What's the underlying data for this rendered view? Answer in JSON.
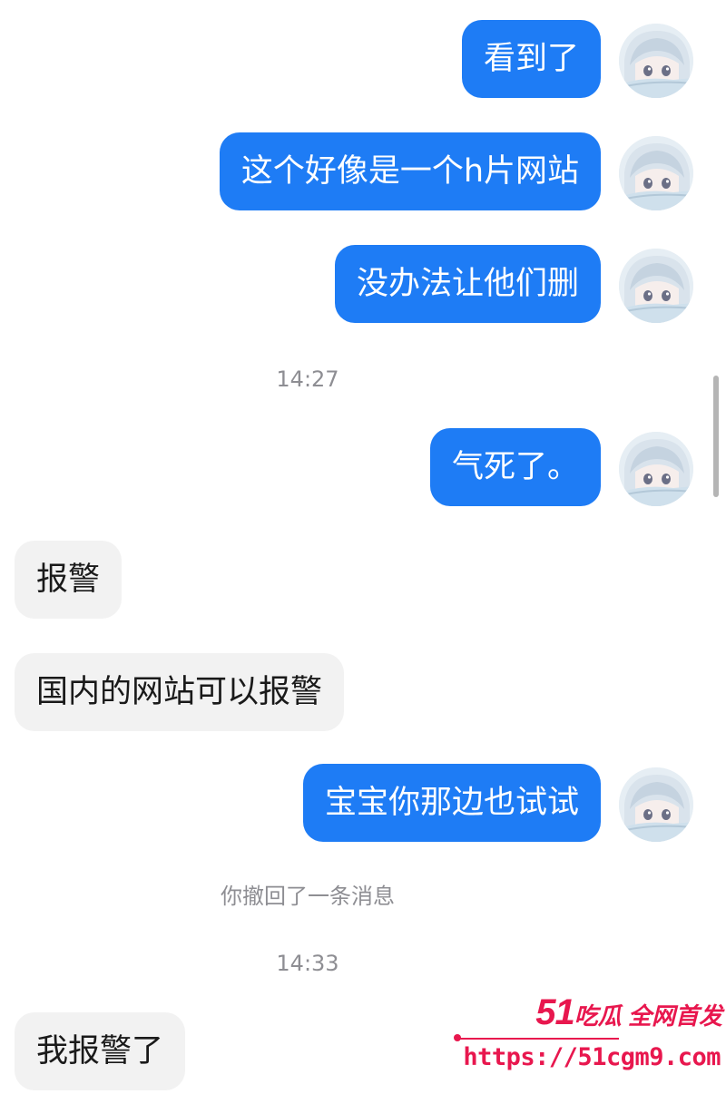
{
  "messages": [
    {
      "side": "out",
      "text": "看到了"
    },
    {
      "side": "out",
      "text": "这个好像是一个h片网站"
    },
    {
      "side": "out",
      "text": "没办法让他们删"
    },
    {
      "timestamp": "14:27"
    },
    {
      "side": "out",
      "text": "气死了。"
    },
    {
      "side": "in",
      "text": "报警"
    },
    {
      "side": "in",
      "text": "国内的网站可以报警"
    },
    {
      "side": "out",
      "text": "宝宝你那边也试试"
    },
    {
      "system": "你撤回了一条消息"
    },
    {
      "timestamp": "14:33"
    },
    {
      "side": "in",
      "text": "我报警了"
    }
  ],
  "watermark": {
    "brand_number": "51",
    "brand_text": "吃瓜 全网首发",
    "url": "https://51cgm9.com"
  },
  "colors": {
    "outgoing_bubble": "#1e7cf5",
    "incoming_bubble": "#f2f2f2",
    "watermark": "#e8174e",
    "meta_text": "#8e8e93"
  },
  "icons": {
    "avatar": "anime-girl-avatar",
    "scrollbar": "scroll-indicator"
  }
}
